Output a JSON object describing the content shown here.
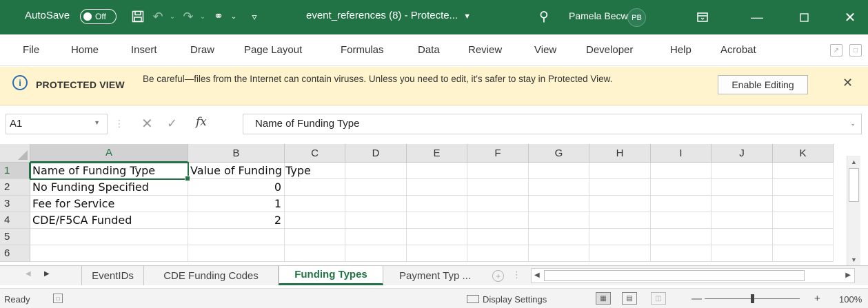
{
  "title_bar": {
    "autosave_label": "AutoSave",
    "autosave_state": "Off",
    "doc_name": "event_references (8)  -  Protecte...",
    "user_name": "Pamela Becwar",
    "user_initials": "PB",
    "accent_color": "#217346"
  },
  "menu": {
    "items": [
      "File",
      "Home",
      "Insert",
      "Draw",
      "Page Layout",
      "Formulas",
      "Data",
      "Review",
      "View",
      "Developer",
      "Help",
      "Acrobat"
    ]
  },
  "protected_view": {
    "title": "PROTECTED VIEW",
    "message": "Be careful—files from the Internet can contain viruses. Unless you need to edit, it's safer to stay in Protected View.",
    "button": "Enable Editing",
    "background_color": "#fff4ce"
  },
  "formula_bar": {
    "name_box": "A1",
    "fx_label": "fx",
    "formula": "Name of Funding Type"
  },
  "grid": {
    "columns": [
      "A",
      "B",
      "C",
      "D",
      "E",
      "F",
      "G",
      "H",
      "I",
      "J",
      "K"
    ],
    "rows": [
      "1",
      "2",
      "3",
      "4",
      "5",
      "6"
    ],
    "cells": {
      "A1": "Name of Funding Type",
      "B1": "Value of Funding Type",
      "A2": "No Funding Specified",
      "B2": "0",
      "A3": "Fee for Service",
      "B3": "1",
      "A4": "CDE/F5CA Funded",
      "B4": "2"
    },
    "active_cell": "A1"
  },
  "sheet_tabs": {
    "tabs": [
      "EventIDs",
      "CDE Funding Codes",
      "Funding Types",
      "Payment Typ ..."
    ],
    "active": "Funding Types"
  },
  "status_bar": {
    "ready": "Ready",
    "display_settings": "Display Settings",
    "zoom": "100%",
    "zoom_minus": "—",
    "zoom_plus": "+"
  }
}
